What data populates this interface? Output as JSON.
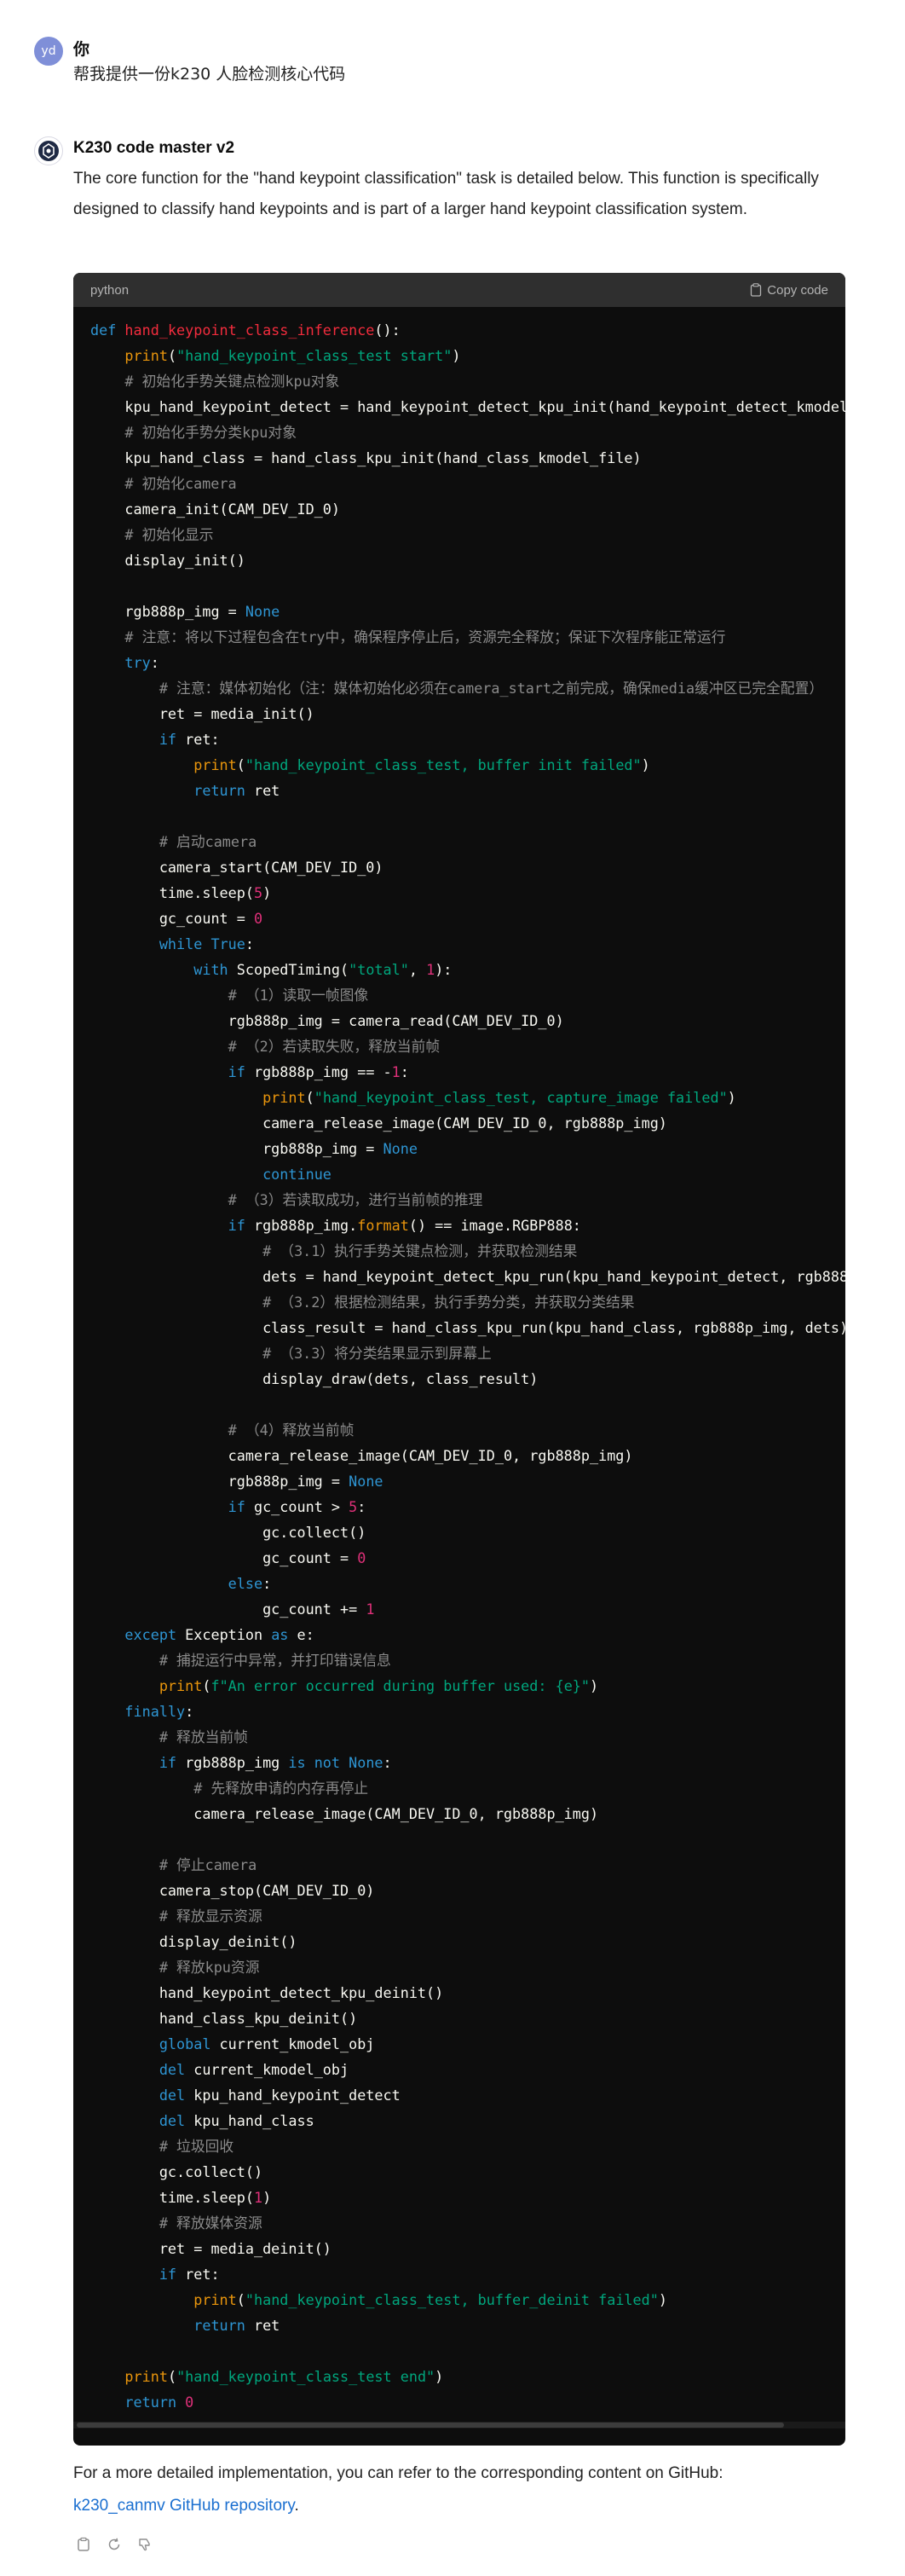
{
  "user": {
    "avatar_initials": "yd",
    "name": "你",
    "message": "帮我提供一份k230 人脸检测核心代码"
  },
  "assistant": {
    "name": "K230 code master v2",
    "intro": "The core function for the \"hand keypoint classification\" task is detailed below. This function is specifically designed to classify hand keypoints and is part of a larger hand keypoint classification system.",
    "code_block": {
      "language": "python",
      "copy_label": "Copy code"
    },
    "footer_text": "For a more detailed implementation, you can refer to the corresponding content on GitHub:",
    "footer_link": "k230_canmv GitHub repository",
    "footer_period": "."
  },
  "icons": {
    "copy": "copy-icon",
    "regenerate": "regenerate-icon",
    "thumbs_down": "thumbs-down-icon"
  },
  "colors": {
    "keyword": "#2e95d3",
    "function_name": "#f22c3d",
    "string": "#00a67d",
    "number": "#df3079",
    "comment": "#8a8a8a",
    "builtin": "#e9950c",
    "code_bg": "#0d0d0d"
  }
}
